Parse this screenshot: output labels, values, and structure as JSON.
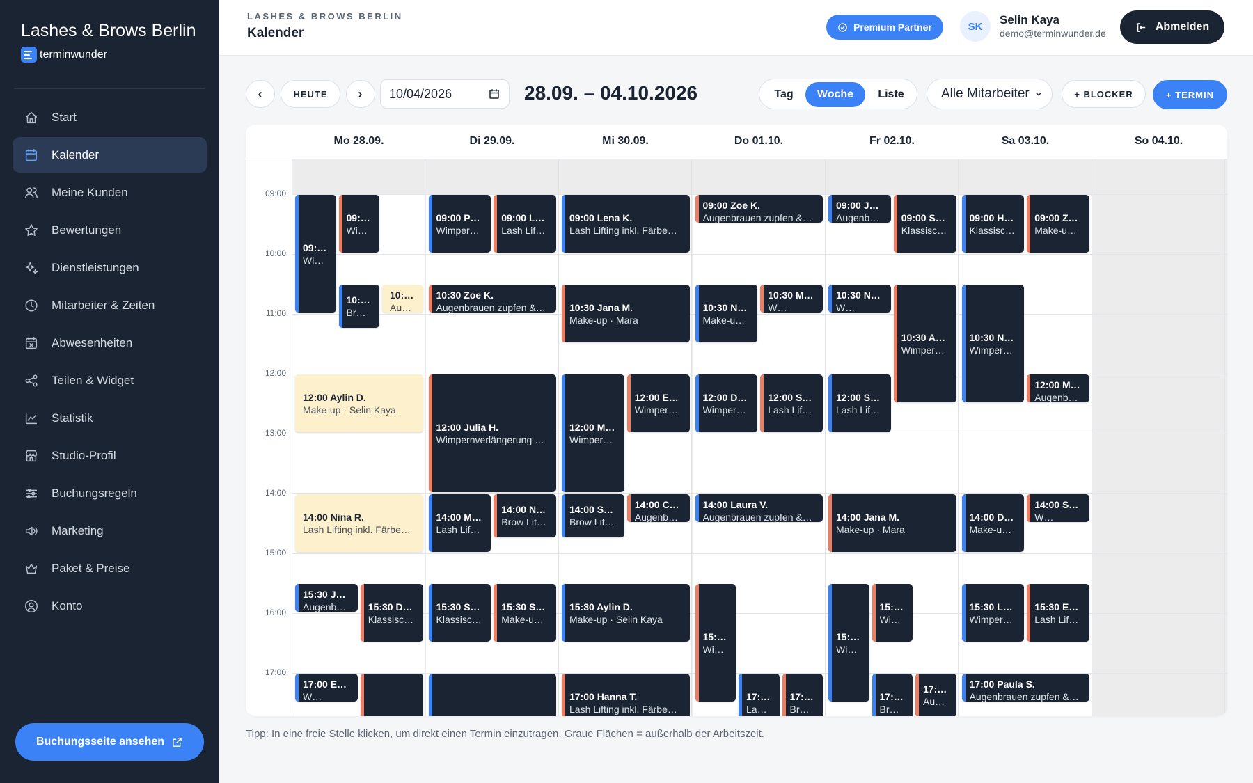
{
  "brand": {
    "title": "Lashes & Brows Berlin",
    "app": "terminwunder"
  },
  "nav": [
    {
      "label": "Start",
      "icon": "home-icon",
      "active": false
    },
    {
      "label": "Kalender",
      "icon": "calendar-icon",
      "active": true
    },
    {
      "label": "Meine Kunden",
      "icon": "users-icon",
      "active": false
    },
    {
      "label": "Bewertungen",
      "icon": "star-icon",
      "active": false
    },
    {
      "label": "Dienstleistungen",
      "icon": "sparkle-icon",
      "active": false
    },
    {
      "label": "Mitarbeiter & Zeiten",
      "icon": "clock-icon",
      "active": false
    },
    {
      "label": "Abwesenheiten",
      "icon": "calendar-x-icon",
      "active": false
    },
    {
      "label": "Teilen & Widget",
      "icon": "share-icon",
      "active": false
    },
    {
      "label": "Statistik",
      "icon": "chart-icon",
      "active": false
    },
    {
      "label": "Studio-Profil",
      "icon": "store-icon",
      "active": false
    },
    {
      "label": "Buchungsregeln",
      "icon": "sliders-icon",
      "active": false
    },
    {
      "label": "Marketing",
      "icon": "megaphone-icon",
      "active": false
    },
    {
      "label": "Paket & Preise",
      "icon": "crown-icon",
      "active": false
    },
    {
      "label": "Konto",
      "icon": "user-circle-icon",
      "active": false
    }
  ],
  "booking_button": "Buchungsseite ansehen",
  "header": {
    "studio": "LASHES & BROWS BERLIN",
    "title": "Kalender",
    "premium": "Premium Partner",
    "avatar": "SK",
    "user_name": "Selin Kaya",
    "user_email": "demo@terminwunder.de",
    "logout": "Abmelden"
  },
  "toolbar": {
    "prev": "‹",
    "today": "HEUTE",
    "next": "›",
    "date_value": "10/04/2026",
    "range": "28.09. – 04.10.2026",
    "views": [
      "Tag",
      "Woche",
      "Liste"
    ],
    "active_view": "Woche",
    "staff": "Alle Mitarbeiter",
    "blocker": "+ BLOCKER",
    "new": "+ TERMIN"
  },
  "days": [
    "Mo 28.09.",
    "Di 29.09.",
    "Mi 30.09.",
    "Do 01.10.",
    "Fr 02.10.",
    "Sa 03.10.",
    "So 04.10."
  ],
  "hours": [
    "09:00",
    "10:00",
    "11:00",
    "12:00",
    "13:00",
    "14:00",
    "15:00",
    "16:00",
    "17:00"
  ],
  "colors": {
    "accent": "#3b82f6",
    "dark": "#1b2433",
    "orange": "#ec7f63",
    "yellow": "#fdf0cc"
  },
  "tip": "Tipp: In eine freie Stelle klicken, um direkt einen Termin einzutragen. Graue Flächen = außerhalb der Arbeitszeit.",
  "events": [
    {
      "day": 0,
      "start": "09:00",
      "end": "11:00",
      "col": 0,
      "cols": 3,
      "title": "09:…",
      "sub": "Wi…",
      "color": "blue"
    },
    {
      "day": 0,
      "start": "09:00",
      "end": "10:00",
      "col": 1,
      "cols": 3,
      "title": "09:…",
      "sub": "Wi…",
      "color": "orange"
    },
    {
      "day": 0,
      "start": "10:30",
      "end": "11:15",
      "col": 1,
      "cols": 3,
      "title": "10:…",
      "sub": "Br…",
      "color": "blue"
    },
    {
      "day": 0,
      "start": "10:30",
      "end": "11:00",
      "col": 2,
      "cols": 3,
      "title": "10:…",
      "sub": "Au…",
      "color": "yellow"
    },
    {
      "day": 0,
      "start": "12:00",
      "end": "13:00",
      "col": 0,
      "cols": 1,
      "title": "12:00 Aylin D.",
      "sub": "Make-up · Selin Kaya",
      "color": "yellow"
    },
    {
      "day": 0,
      "start": "14:00",
      "end": "15:00",
      "col": 0,
      "cols": 1,
      "title": "14:00 Nina R.",
      "sub": "Lash Lifting inkl. Färbe…",
      "color": "yellow"
    },
    {
      "day": 0,
      "start": "15:30",
      "end": "16:00",
      "col": 0,
      "cols": 2,
      "title": "15:30 J…",
      "sub": "Augenb…",
      "color": "blue"
    },
    {
      "day": 0,
      "start": "15:30",
      "end": "16:30",
      "col": 1,
      "cols": 2,
      "title": "15:30 D…",
      "sub": "Klassisc…",
      "color": "orange"
    },
    {
      "day": 0,
      "start": "17:00",
      "end": "17:30",
      "col": 0,
      "cols": 2,
      "title": "17:00 E…",
      "sub": "W…",
      "color": "blue"
    },
    {
      "day": 0,
      "start": "17:00",
      "end": "18:00",
      "col": 1,
      "cols": 2,
      "title": "",
      "sub": "",
      "color": "orange"
    },
    {
      "day": 1,
      "start": "09:00",
      "end": "10:00",
      "col": 0,
      "cols": 2,
      "title": "09:00 P…",
      "sub": "Wimper…",
      "color": "blue"
    },
    {
      "day": 1,
      "start": "09:00",
      "end": "10:00",
      "col": 1,
      "cols": 2,
      "title": "09:00 L…",
      "sub": "Lash Lif…",
      "color": "orange"
    },
    {
      "day": 1,
      "start": "10:30",
      "end": "11:00",
      "col": 0,
      "cols": 1,
      "title": "10:30 Zoe K.",
      "sub": "Augenbrauen zupfen &…",
      "color": "orange"
    },
    {
      "day": 1,
      "start": "12:00",
      "end": "14:00",
      "col": 0,
      "cols": 1,
      "title": "12:00 Julia H.",
      "sub": "Wimpernverlängerung …",
      "color": "orange"
    },
    {
      "day": 1,
      "start": "14:00",
      "end": "15:00",
      "col": 0,
      "cols": 2,
      "title": "14:00 M…",
      "sub": "Lash Lif…",
      "color": "blue"
    },
    {
      "day": 1,
      "start": "14:00",
      "end": "14:45",
      "col": 1,
      "cols": 2,
      "title": "14:00 N…",
      "sub": "Brow Lif…",
      "color": "orange"
    },
    {
      "day": 1,
      "start": "15:30",
      "end": "16:30",
      "col": 0,
      "cols": 2,
      "title": "15:30 S…",
      "sub": "Klassisc…",
      "color": "blue"
    },
    {
      "day": 1,
      "start": "15:30",
      "end": "16:30",
      "col": 1,
      "cols": 2,
      "title": "15:30 S…",
      "sub": "Make-u…",
      "color": "orange"
    },
    {
      "day": 1,
      "start": "17:00",
      "end": "18:00",
      "col": 0,
      "cols": 1,
      "title": "",
      "sub": "",
      "color": "blue"
    },
    {
      "day": 2,
      "start": "09:00",
      "end": "10:00",
      "col": 0,
      "cols": 1,
      "title": "09:00 Lena K.",
      "sub": "Lash Lifting inkl. Färbe…",
      "color": "blue"
    },
    {
      "day": 2,
      "start": "10:30",
      "end": "11:30",
      "col": 0,
      "cols": 1,
      "title": "10:30 Jana M.",
      "sub": "Make-up · Mara",
      "color": "orange"
    },
    {
      "day": 2,
      "start": "12:00",
      "end": "14:00",
      "col": 0,
      "cols": 2,
      "title": "12:00 M…",
      "sub": "Wimper…",
      "color": "blue"
    },
    {
      "day": 2,
      "start": "12:00",
      "end": "13:00",
      "col": 1,
      "cols": 2,
      "title": "12:00 E…",
      "sub": "Wimper…",
      "color": "orange"
    },
    {
      "day": 2,
      "start": "14:00",
      "end": "14:45",
      "col": 0,
      "cols": 2,
      "title": "14:00 S…",
      "sub": "Brow Lif…",
      "color": "blue"
    },
    {
      "day": 2,
      "start": "14:00",
      "end": "14:30",
      "col": 1,
      "cols": 2,
      "title": "14:00 C…",
      "sub": "Augenb…",
      "color": "orange"
    },
    {
      "day": 2,
      "start": "15:30",
      "end": "16:30",
      "col": 0,
      "cols": 1,
      "title": "15:30 Aylin D.",
      "sub": "Make-up · Selin Kaya",
      "color": "blue"
    },
    {
      "day": 2,
      "start": "17:00",
      "end": "18:00",
      "col": 0,
      "cols": 1,
      "title": "17:00 Hanna T.",
      "sub": "Lash Lifting inkl. Färbe…",
      "color": "orange"
    },
    {
      "day": 3,
      "start": "09:00",
      "end": "09:30",
      "col": 0,
      "cols": 1,
      "title": "09:00 Zoe K.",
      "sub": "Augenbrauen zupfen &…",
      "color": "orange"
    },
    {
      "day": 3,
      "start": "10:30",
      "end": "11:30",
      "col": 0,
      "cols": 2,
      "title": "10:30 N…",
      "sub": "Make-u…",
      "color": "blue"
    },
    {
      "day": 3,
      "start": "10:30",
      "end": "11:00",
      "col": 1,
      "cols": 2,
      "title": "10:30 M…",
      "sub": "W…",
      "color": "orange"
    },
    {
      "day": 3,
      "start": "12:00",
      "end": "13:00",
      "col": 0,
      "cols": 2,
      "title": "12:00 D…",
      "sub": "Wimper…",
      "color": "blue"
    },
    {
      "day": 3,
      "start": "12:00",
      "end": "13:00",
      "col": 1,
      "cols": 2,
      "title": "12:00 S…",
      "sub": "Lash Lif…",
      "color": "orange"
    },
    {
      "day": 3,
      "start": "14:00",
      "end": "14:30",
      "col": 0,
      "cols": 1,
      "title": "14:00 Laura V.",
      "sub": "Augenbrauen zupfen &…",
      "color": "blue"
    },
    {
      "day": 3,
      "start": "15:30",
      "end": "17:30",
      "col": 0,
      "cols": 3,
      "title": "15:…",
      "sub": "Wi…",
      "color": "orange"
    },
    {
      "day": 3,
      "start": "17:00",
      "end": "18:00",
      "col": 1,
      "cols": 3,
      "title": "17:…",
      "sub": "La…",
      "color": "blue"
    },
    {
      "day": 3,
      "start": "17:00",
      "end": "18:00",
      "col": 2,
      "cols": 3,
      "title": "17:…",
      "sub": "Br…",
      "color": "orange"
    },
    {
      "day": 4,
      "start": "09:00",
      "end": "09:30",
      "col": 0,
      "cols": 2,
      "title": "09:00 J…",
      "sub": "Augenb…",
      "color": "blue"
    },
    {
      "day": 4,
      "start": "09:00",
      "end": "10:00",
      "col": 1,
      "cols": 2,
      "title": "09:00 S…",
      "sub": "Klassisc…",
      "color": "orange"
    },
    {
      "day": 4,
      "start": "10:30",
      "end": "11:00",
      "col": 0,
      "cols": 2,
      "title": "10:30 N…",
      "sub": "W…",
      "color": "blue"
    },
    {
      "day": 4,
      "start": "10:30",
      "end": "12:30",
      "col": 1,
      "cols": 2,
      "title": "10:30 A…",
      "sub": "Wimper…",
      "color": "orange"
    },
    {
      "day": 4,
      "start": "12:00",
      "end": "13:00",
      "col": 0,
      "cols": 2,
      "title": "12:00 S…",
      "sub": "Lash Lif…",
      "color": "blue"
    },
    {
      "day": 4,
      "start": "14:00",
      "end": "15:00",
      "col": 0,
      "cols": 1,
      "title": "14:00 Jana M.",
      "sub": "Make-up · Mara",
      "color": "orange"
    },
    {
      "day": 4,
      "start": "15:30",
      "end": "17:30",
      "col": 0,
      "cols": 3,
      "title": "15:…",
      "sub": "Wi…",
      "color": "blue"
    },
    {
      "day": 4,
      "start": "15:30",
      "end": "16:30",
      "col": 1,
      "cols": 3,
      "title": "15:…",
      "sub": "Wi…",
      "color": "orange"
    },
    {
      "day": 4,
      "start": "17:00",
      "end": "18:00",
      "col": 1,
      "cols": 3,
      "title": "17:…",
      "sub": "Br…",
      "color": "blue"
    },
    {
      "day": 4,
      "start": "17:00",
      "end": "17:45",
      "col": 2,
      "cols": 3,
      "title": "17:…",
      "sub": "Au…",
      "color": "orange"
    },
    {
      "day": 5,
      "start": "09:00",
      "end": "10:00",
      "col": 0,
      "cols": 2,
      "title": "09:00 H…",
      "sub": "Klassisc…",
      "color": "blue"
    },
    {
      "day": 5,
      "start": "09:00",
      "end": "10:00",
      "col": 1,
      "cols": 2,
      "title": "09:00 Z…",
      "sub": "Make-u…",
      "color": "orange"
    },
    {
      "day": 5,
      "start": "10:30",
      "end": "12:30",
      "col": 0,
      "cols": 2,
      "title": "10:30 N…",
      "sub": "Wimper…",
      "color": "blue"
    },
    {
      "day": 5,
      "start": "12:00",
      "end": "12:30",
      "col": 1,
      "cols": 2,
      "title": "12:00 M…",
      "sub": "Augenb…",
      "color": "orange"
    },
    {
      "day": 5,
      "start": "14:00",
      "end": "15:00",
      "col": 0,
      "cols": 2,
      "title": "14:00 D…",
      "sub": "Make-u…",
      "color": "blue"
    },
    {
      "day": 5,
      "start": "14:00",
      "end": "14:30",
      "col": 1,
      "cols": 2,
      "title": "14:00 S…",
      "sub": "W…",
      "color": "orange"
    },
    {
      "day": 5,
      "start": "15:30",
      "end": "16:30",
      "col": 0,
      "cols": 2,
      "title": "15:30 L…",
      "sub": "Wimper…",
      "color": "blue"
    },
    {
      "day": 5,
      "start": "15:30",
      "end": "16:30",
      "col": 1,
      "cols": 2,
      "title": "15:30 E…",
      "sub": "Lash Lif…",
      "color": "orange"
    },
    {
      "day": 5,
      "start": "17:00",
      "end": "17:30",
      "col": 0,
      "cols": 1,
      "title": "17:00 Paula S.",
      "sub": "Augenbrauen zupfen &…",
      "color": "blue"
    }
  ]
}
